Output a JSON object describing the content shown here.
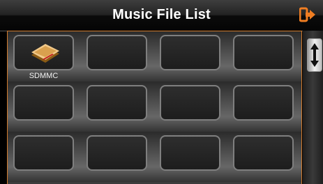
{
  "header": {
    "title": "Music File List",
    "exit_icon": "exit-icon"
  },
  "grid": {
    "tiles": [
      {
        "label": "SDMMC",
        "icon": "sd-card-folder-icon"
      },
      {
        "label": ""
      },
      {
        "label": ""
      },
      {
        "label": ""
      },
      {
        "label": ""
      },
      {
        "label": ""
      },
      {
        "label": ""
      },
      {
        "label": ""
      },
      {
        "label": ""
      },
      {
        "label": ""
      },
      {
        "label": ""
      },
      {
        "label": ""
      }
    ]
  },
  "scrollbar": {
    "icon": "up-down-arrows-icon"
  },
  "colors": {
    "accent": "#e8791f",
    "panel_border": "#d27b2d"
  }
}
